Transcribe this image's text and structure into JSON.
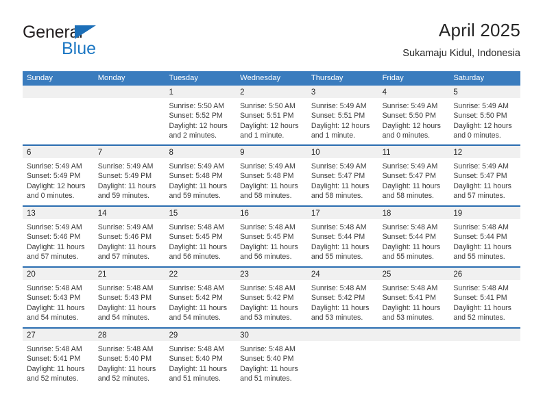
{
  "logo": {
    "word_top": "General",
    "word_bottom": "Blue",
    "triangle_color": "#1c6fb8",
    "top_color": "#231f20",
    "bottom_color": "#1c77c3"
  },
  "header": {
    "title": "April 2025",
    "subtitle": "Sukamaju Kidul, Indonesia"
  },
  "theme": {
    "header_bar": "#3a7cbe",
    "week_divider": "#2a6db0",
    "day_band": "#f0f0f0",
    "text": "#262626"
  },
  "weekdays": [
    "Sunday",
    "Monday",
    "Tuesday",
    "Wednesday",
    "Thursday",
    "Friday",
    "Saturday"
  ],
  "weeks": [
    [
      {
        "day": "",
        "lines": []
      },
      {
        "day": "",
        "lines": []
      },
      {
        "day": "1",
        "lines": [
          "Sunrise: 5:50 AM",
          "Sunset: 5:52 PM",
          "Daylight: 12 hours",
          "and 2 minutes."
        ]
      },
      {
        "day": "2",
        "lines": [
          "Sunrise: 5:50 AM",
          "Sunset: 5:51 PM",
          "Daylight: 12 hours",
          "and 1 minute."
        ]
      },
      {
        "day": "3",
        "lines": [
          "Sunrise: 5:49 AM",
          "Sunset: 5:51 PM",
          "Daylight: 12 hours",
          "and 1 minute."
        ]
      },
      {
        "day": "4",
        "lines": [
          "Sunrise: 5:49 AM",
          "Sunset: 5:50 PM",
          "Daylight: 12 hours",
          "and 0 minutes."
        ]
      },
      {
        "day": "5",
        "lines": [
          "Sunrise: 5:49 AM",
          "Sunset: 5:50 PM",
          "Daylight: 12 hours",
          "and 0 minutes."
        ]
      }
    ],
    [
      {
        "day": "6",
        "lines": [
          "Sunrise: 5:49 AM",
          "Sunset: 5:49 PM",
          "Daylight: 12 hours",
          "and 0 minutes."
        ]
      },
      {
        "day": "7",
        "lines": [
          "Sunrise: 5:49 AM",
          "Sunset: 5:49 PM",
          "Daylight: 11 hours",
          "and 59 minutes."
        ]
      },
      {
        "day": "8",
        "lines": [
          "Sunrise: 5:49 AM",
          "Sunset: 5:48 PM",
          "Daylight: 11 hours",
          "and 59 minutes."
        ]
      },
      {
        "day": "9",
        "lines": [
          "Sunrise: 5:49 AM",
          "Sunset: 5:48 PM",
          "Daylight: 11 hours",
          "and 58 minutes."
        ]
      },
      {
        "day": "10",
        "lines": [
          "Sunrise: 5:49 AM",
          "Sunset: 5:47 PM",
          "Daylight: 11 hours",
          "and 58 minutes."
        ]
      },
      {
        "day": "11",
        "lines": [
          "Sunrise: 5:49 AM",
          "Sunset: 5:47 PM",
          "Daylight: 11 hours",
          "and 58 minutes."
        ]
      },
      {
        "day": "12",
        "lines": [
          "Sunrise: 5:49 AM",
          "Sunset: 5:47 PM",
          "Daylight: 11 hours",
          "and 57 minutes."
        ]
      }
    ],
    [
      {
        "day": "13",
        "lines": [
          "Sunrise: 5:49 AM",
          "Sunset: 5:46 PM",
          "Daylight: 11 hours",
          "and 57 minutes."
        ]
      },
      {
        "day": "14",
        "lines": [
          "Sunrise: 5:49 AM",
          "Sunset: 5:46 PM",
          "Daylight: 11 hours",
          "and 57 minutes."
        ]
      },
      {
        "day": "15",
        "lines": [
          "Sunrise: 5:48 AM",
          "Sunset: 5:45 PM",
          "Daylight: 11 hours",
          "and 56 minutes."
        ]
      },
      {
        "day": "16",
        "lines": [
          "Sunrise: 5:48 AM",
          "Sunset: 5:45 PM",
          "Daylight: 11 hours",
          "and 56 minutes."
        ]
      },
      {
        "day": "17",
        "lines": [
          "Sunrise: 5:48 AM",
          "Sunset: 5:44 PM",
          "Daylight: 11 hours",
          "and 55 minutes."
        ]
      },
      {
        "day": "18",
        "lines": [
          "Sunrise: 5:48 AM",
          "Sunset: 5:44 PM",
          "Daylight: 11 hours",
          "and 55 minutes."
        ]
      },
      {
        "day": "19",
        "lines": [
          "Sunrise: 5:48 AM",
          "Sunset: 5:44 PM",
          "Daylight: 11 hours",
          "and 55 minutes."
        ]
      }
    ],
    [
      {
        "day": "20",
        "lines": [
          "Sunrise: 5:48 AM",
          "Sunset: 5:43 PM",
          "Daylight: 11 hours",
          "and 54 minutes."
        ]
      },
      {
        "day": "21",
        "lines": [
          "Sunrise: 5:48 AM",
          "Sunset: 5:43 PM",
          "Daylight: 11 hours",
          "and 54 minutes."
        ]
      },
      {
        "day": "22",
        "lines": [
          "Sunrise: 5:48 AM",
          "Sunset: 5:42 PM",
          "Daylight: 11 hours",
          "and 54 minutes."
        ]
      },
      {
        "day": "23",
        "lines": [
          "Sunrise: 5:48 AM",
          "Sunset: 5:42 PM",
          "Daylight: 11 hours",
          "and 53 minutes."
        ]
      },
      {
        "day": "24",
        "lines": [
          "Sunrise: 5:48 AM",
          "Sunset: 5:42 PM",
          "Daylight: 11 hours",
          "and 53 minutes."
        ]
      },
      {
        "day": "25",
        "lines": [
          "Sunrise: 5:48 AM",
          "Sunset: 5:41 PM",
          "Daylight: 11 hours",
          "and 53 minutes."
        ]
      },
      {
        "day": "26",
        "lines": [
          "Sunrise: 5:48 AM",
          "Sunset: 5:41 PM",
          "Daylight: 11 hours",
          "and 52 minutes."
        ]
      }
    ],
    [
      {
        "day": "27",
        "lines": [
          "Sunrise: 5:48 AM",
          "Sunset: 5:41 PM",
          "Daylight: 11 hours",
          "and 52 minutes."
        ]
      },
      {
        "day": "28",
        "lines": [
          "Sunrise: 5:48 AM",
          "Sunset: 5:40 PM",
          "Daylight: 11 hours",
          "and 52 minutes."
        ]
      },
      {
        "day": "29",
        "lines": [
          "Sunrise: 5:48 AM",
          "Sunset: 5:40 PM",
          "Daylight: 11 hours",
          "and 51 minutes."
        ]
      },
      {
        "day": "30",
        "lines": [
          "Sunrise: 5:48 AM",
          "Sunset: 5:40 PM",
          "Daylight: 11 hours",
          "and 51 minutes."
        ]
      },
      {
        "day": "",
        "lines": []
      },
      {
        "day": "",
        "lines": []
      },
      {
        "day": "",
        "lines": []
      }
    ]
  ]
}
